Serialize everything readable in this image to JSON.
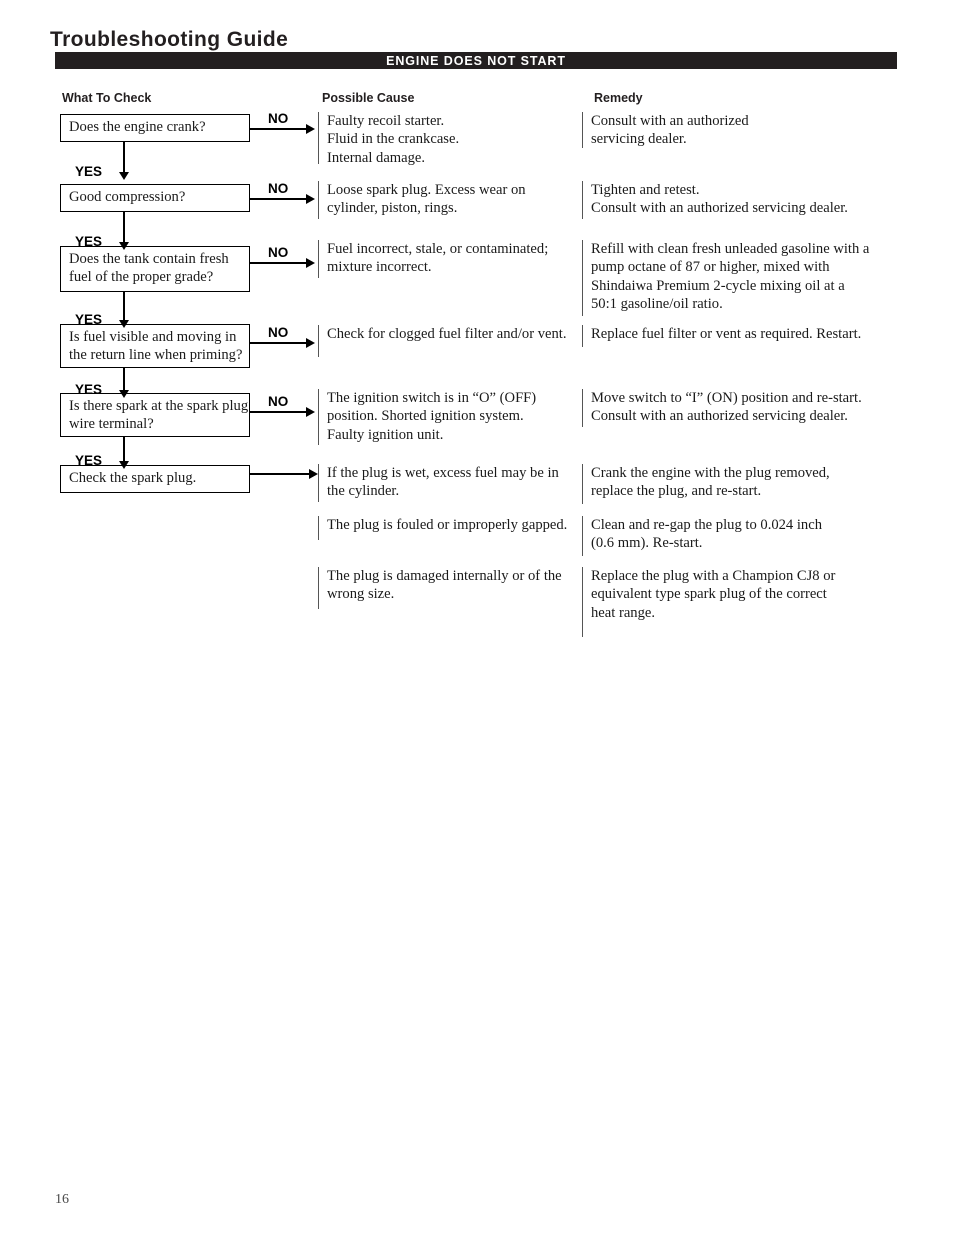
{
  "document": {
    "title": "Troubleshooting Guide",
    "section_banner": "ENGINE DOES NOT START",
    "page_number": "16",
    "banner_background": "#231f20",
    "banner_text_color": "#ffffff"
  },
  "columns": {
    "check": "What To Check",
    "cause": "Possible Cause",
    "remedy": "Remedy"
  },
  "labels": {
    "yes": "YES",
    "no": "NO"
  },
  "rows": [
    {
      "check": "Does the engine crank?",
      "cause": "Faulty recoil starter.\nFluid in the crankcase.\nInternal damage.",
      "remedy": "Consult with an authorized\nservicing dealer.",
      "branch_label": "NO"
    },
    {
      "check": "Good compression?",
      "cause": "Loose spark plug. Excess wear on\ncylinder, piston, rings.",
      "remedy": "Tighten and retest.\nConsult with an authorized servicing dealer.",
      "branch_label": "NO"
    },
    {
      "check": "Does the tank contain fresh\nfuel of the proper grade?",
      "cause": "Fuel incorrect, stale, or contaminated;\nmixture incorrect.",
      "remedy": "Refill with clean fresh unleaded gasoline with a\npump octane of 87 or higher, mixed with\nShindaiwa Premium 2-cycle mixing oil at a\n50:1 gasoline/oil ratio.",
      "branch_label": "NO"
    },
    {
      "check": "Is fuel visible and moving in\nthe return line when priming?",
      "cause": "Check for clogged fuel filter and/or vent.",
      "remedy": "Replace fuel filter or vent as required. Restart.",
      "branch_label": "NO"
    },
    {
      "check": "Is there spark at the spark\nplug wire terminal?",
      "cause": "The ignition switch is in “O” (OFF)\nposition. Shorted ignition system.\nFaulty ignition unit.",
      "remedy": "Move switch to “I” (ON) position and re-start.\nConsult with an authorized servicing dealer.",
      "branch_label": "NO"
    },
    {
      "check": "Check the spark plug.",
      "cause": "If the plug is wet, excess fuel may be in\nthe cylinder.",
      "remedy": "Crank the engine with the plug removed,\nreplace the plug, and re-start.",
      "branch_label": ""
    }
  ],
  "extra_plug_conditions": [
    {
      "cause": "The plug is fouled or improperly gapped.",
      "remedy": "Clean and re-gap the plug to 0.024 inch\n(0.6 mm). Re-start."
    },
    {
      "cause": "The plug is damaged internally or of the\nwrong size.",
      "remedy": "Replace the plug with a Champion CJ8 or\nequivalent type spark plug of the correct\nheat range."
    }
  ]
}
